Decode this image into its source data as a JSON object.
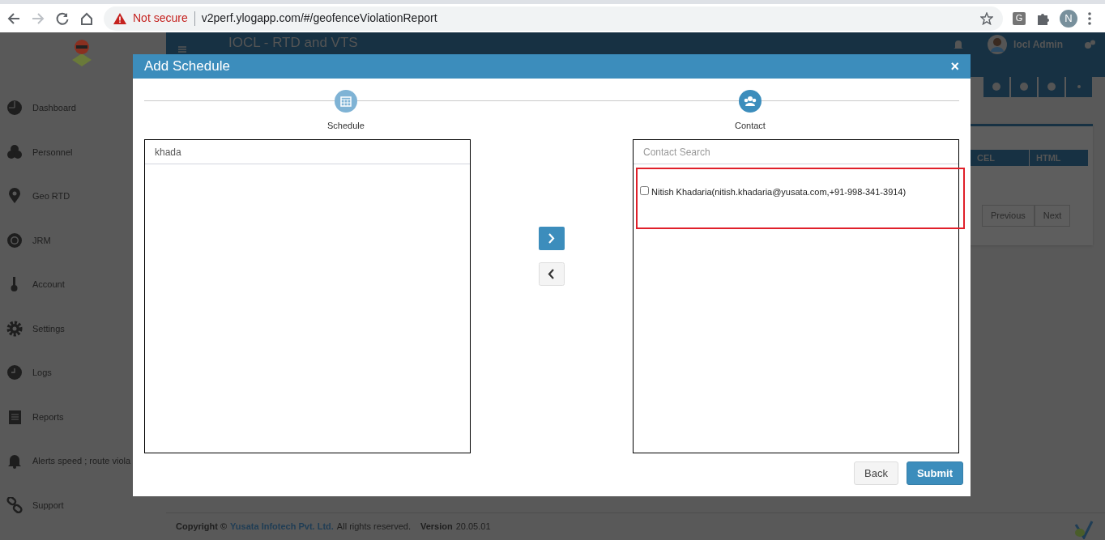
{
  "browser": {
    "security": "Not secure",
    "url": "v2perf.ylogapp.com/#/geofenceViolationReport",
    "profile": "N",
    "extension": "G"
  },
  "app": {
    "title": "IOCL - RTD and VTS",
    "user": "Iocl Admin",
    "sidebar": [
      {
        "label": "Dashboard"
      },
      {
        "label": "Personnel"
      },
      {
        "label": "Geo RTD"
      },
      {
        "label": "JRM"
      },
      {
        "label": "Account"
      },
      {
        "label": "Settings"
      },
      {
        "label": "Logs"
      },
      {
        "label": "Reports"
      },
      {
        "label": "Alerts speed ; route viola"
      },
      {
        "label": "Support"
      }
    ],
    "table_columns": [
      "CEL",
      "HTML"
    ],
    "pagination": [
      "Previous",
      "Next"
    ],
    "footer": {
      "copyright": "Copyright ©",
      "company": "Yusata Infotech Pvt. Ltd.",
      "rights": "All rights reserved.",
      "version_label": "Version",
      "version": "20.05.01"
    }
  },
  "modal": {
    "title": "Add Schedule",
    "close": "×",
    "steps": [
      {
        "label": "Schedule"
      },
      {
        "label": "Contact"
      }
    ],
    "schedule_search": {
      "value": "khada"
    },
    "contact_search": {
      "placeholder": "Contact Search"
    },
    "contacts": [
      {
        "label": "Nitish Khadaria(nitish.khadaria@yusata.com,+91-998-341-3914)",
        "checked": false,
        "highlighted": true
      }
    ],
    "buttons": [
      "Back",
      "Submit"
    ]
  }
}
